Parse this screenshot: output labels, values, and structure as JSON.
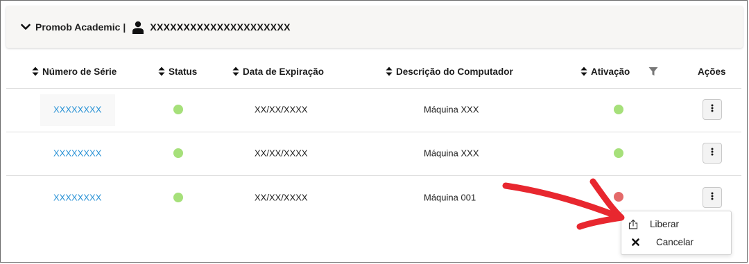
{
  "header": {
    "title": "Promob Academic",
    "separator": "|",
    "user": "XXXXXXXXXXXXXXXXXXXXX",
    "icons": [
      "chevron-down-icon",
      "user-icon"
    ]
  },
  "table": {
    "columns": [
      {
        "label": "Número de Série",
        "sortable": true
      },
      {
        "label": "Status",
        "sortable": true
      },
      {
        "label": "Data de Expiração",
        "sortable": true
      },
      {
        "label": "Descrição do Computador",
        "sortable": true
      },
      {
        "label": "Ativação",
        "sortable": true,
        "filter_icon": "filter-icon"
      },
      {
        "label": "Ações",
        "sortable": false
      }
    ],
    "rows": [
      {
        "serial": "XXXXXXXX",
        "status": "active",
        "expiration": "XX/XX/XXXX",
        "description": "Máquina XXX",
        "activation": "active"
      },
      {
        "serial": "XXXXXXXX",
        "status": "active",
        "expiration": "XX/XX/XXXX",
        "description": "Máquina XXX",
        "activation": "active"
      },
      {
        "serial": "XXXXXXXX",
        "status": "active",
        "expiration": "XX/XX/XXXX",
        "description": "Máquina 001",
        "activation": "inactive"
      }
    ]
  },
  "context_menu": {
    "items": [
      {
        "label": "Liberar",
        "icon": "share-export-icon"
      },
      {
        "label": "Cancelar",
        "icon": "close-icon"
      }
    ]
  },
  "colors": {
    "link": "#2b93d6",
    "status_green": "#a6e07a",
    "status_red": "#e46a6a",
    "annotation_arrow": "#e8272f"
  }
}
